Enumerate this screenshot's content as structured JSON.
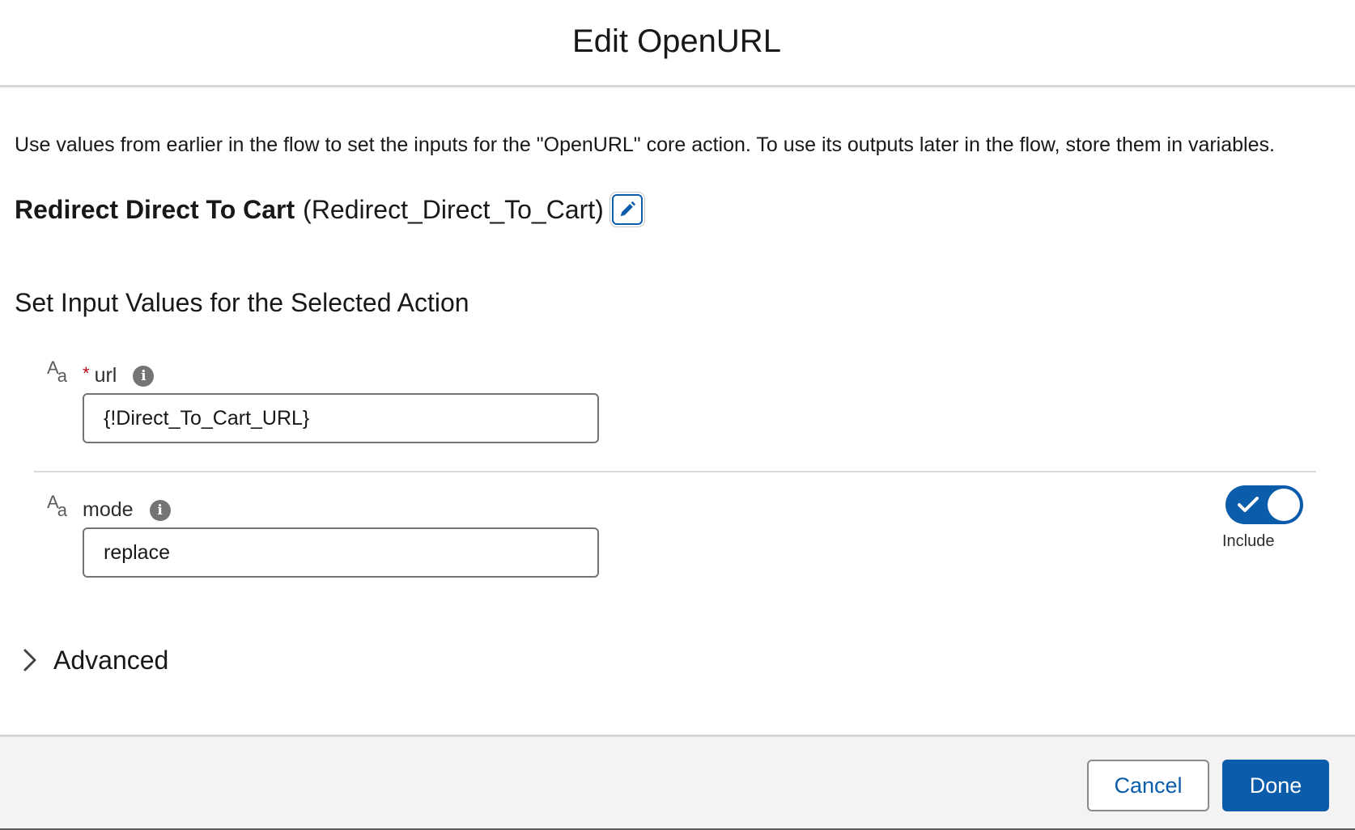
{
  "header": {
    "title": "Edit OpenURL"
  },
  "description": "Use values from earlier in the flow to set the inputs for the \"OpenURL\" core action. To use its outputs later in the flow, store them in variables.",
  "action": {
    "label": "Redirect Direct To Cart",
    "api_name": "(Redirect_Direct_To_Cart)",
    "edit_icon": "pencil-icon"
  },
  "section_title": "Set Input Values for the Selected Action",
  "fields": {
    "url": {
      "type_icon_big": "A",
      "type_icon_small": "a",
      "required_marker": "*",
      "label": "url",
      "info_icon": "i",
      "value": "{!Direct_To_Cart_URL}"
    },
    "mode": {
      "type_icon_big": "A",
      "type_icon_small": "a",
      "label": "mode",
      "info_icon": "i",
      "value": "replace",
      "include_label": "Include",
      "include_on": true
    }
  },
  "advanced": {
    "label": "Advanced",
    "icon": "chevron-right-icon"
  },
  "footer": {
    "cancel_label": "Cancel",
    "done_label": "Done"
  },
  "colors": {
    "brand": "#0b5cab",
    "required": "#ba0517",
    "footer_bg": "#f3f3f3"
  }
}
